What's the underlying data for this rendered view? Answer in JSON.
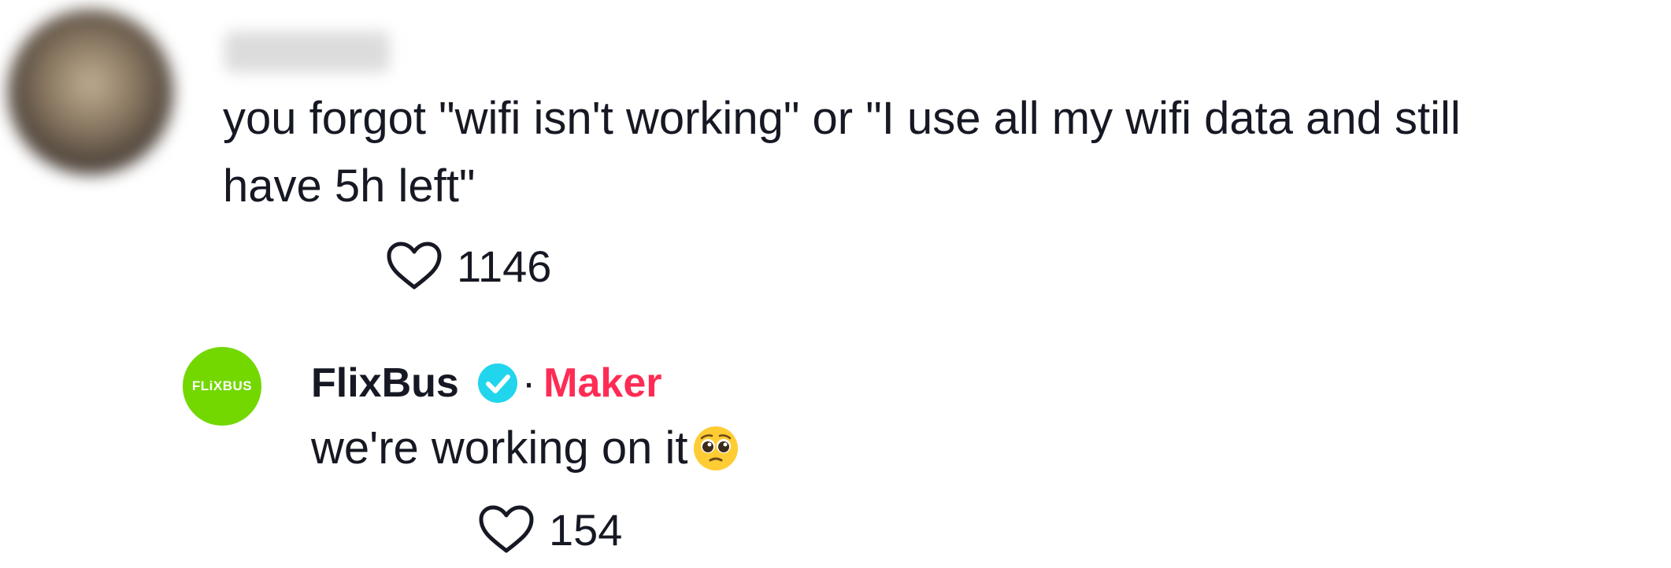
{
  "comment": {
    "avatar": "user-avatar-blurred",
    "username": "",
    "text": "you forgot \"wifi isn't working\" or \"I use all my wifi data and still\nhave 5h left\"",
    "like_icon": "heart-outline-icon",
    "likes": "1146"
  },
  "reply": {
    "avatar_text": "FLiXBUS",
    "author": "FlixBus",
    "verified_icon": "verified-badge-icon",
    "separator": "·",
    "role": "Maker",
    "text": "we're working on it",
    "emoji": "pleading-face-emoji",
    "like_icon": "heart-outline-icon",
    "likes": "154"
  },
  "colors": {
    "text": "#161823",
    "maker": "#fe2c55",
    "verified": "#20d5ec",
    "brand": "#73d700",
    "heart_stroke": "#161823"
  }
}
